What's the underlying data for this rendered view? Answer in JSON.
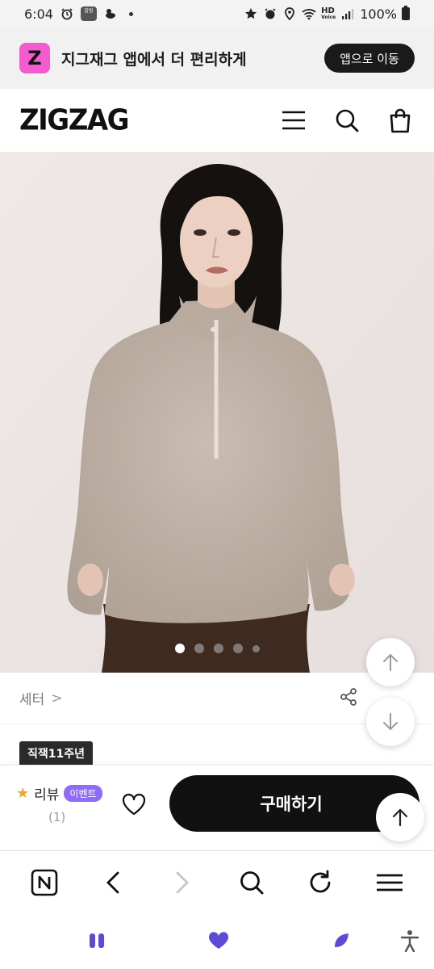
{
  "status_bar": {
    "time": "6:04",
    "battery": "100%",
    "hd_voice": "HD",
    "hd_voice_sub": "Voice",
    "app_icon_text": "알림"
  },
  "app_banner": {
    "logo_letter": "Z",
    "text": "지그재그 앱에서 더 편리하게",
    "button_label": "앱으로 이동"
  },
  "header": {
    "brand": "ZIGZAG"
  },
  "hero": {
    "slide_count": 5,
    "active_slide": 1
  },
  "category": {
    "label": "세터",
    "chevron": ">"
  },
  "badge": {
    "label": "직잭11주년"
  },
  "purchase_bar": {
    "review_label": "리뷰",
    "event_label": "이벤트",
    "review_count": "(1)",
    "buy_label": "구매하기"
  },
  "colors": {
    "accent_pink": "#f35ccf",
    "event_purple": "#8f6cf7",
    "nav_purple": "#5b4bd6",
    "buy_button": "#111111"
  }
}
